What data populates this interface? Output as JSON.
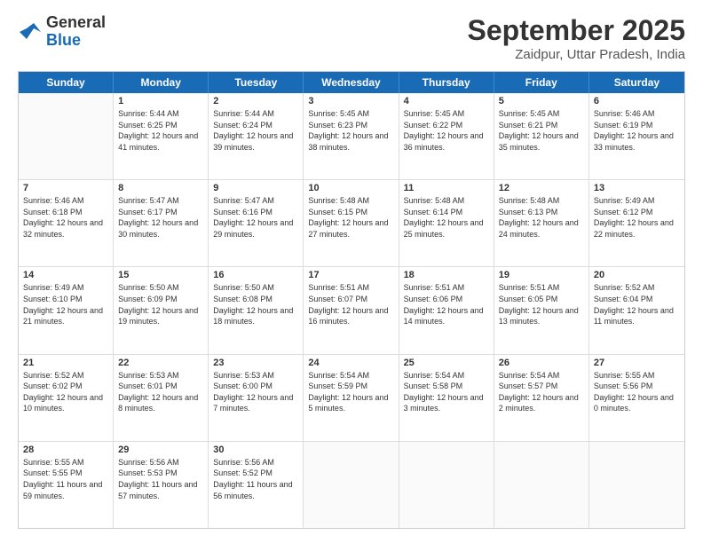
{
  "logo": {
    "general": "General",
    "blue": "Blue"
  },
  "header": {
    "month": "September 2025",
    "location": "Zaidpur, Uttar Pradesh, India"
  },
  "days": [
    "Sunday",
    "Monday",
    "Tuesday",
    "Wednesday",
    "Thursday",
    "Friday",
    "Saturday"
  ],
  "rows": [
    [
      {
        "day": "",
        "empty": true
      },
      {
        "day": "1",
        "sunrise": "Sunrise: 5:44 AM",
        "sunset": "Sunset: 6:25 PM",
        "daylight": "Daylight: 12 hours and 41 minutes."
      },
      {
        "day": "2",
        "sunrise": "Sunrise: 5:44 AM",
        "sunset": "Sunset: 6:24 PM",
        "daylight": "Daylight: 12 hours and 39 minutes."
      },
      {
        "day": "3",
        "sunrise": "Sunrise: 5:45 AM",
        "sunset": "Sunset: 6:23 PM",
        "daylight": "Daylight: 12 hours and 38 minutes."
      },
      {
        "day": "4",
        "sunrise": "Sunrise: 5:45 AM",
        "sunset": "Sunset: 6:22 PM",
        "daylight": "Daylight: 12 hours and 36 minutes."
      },
      {
        "day": "5",
        "sunrise": "Sunrise: 5:45 AM",
        "sunset": "Sunset: 6:21 PM",
        "daylight": "Daylight: 12 hours and 35 minutes."
      },
      {
        "day": "6",
        "sunrise": "Sunrise: 5:46 AM",
        "sunset": "Sunset: 6:19 PM",
        "daylight": "Daylight: 12 hours and 33 minutes."
      }
    ],
    [
      {
        "day": "7",
        "sunrise": "Sunrise: 5:46 AM",
        "sunset": "Sunset: 6:18 PM",
        "daylight": "Daylight: 12 hours and 32 minutes."
      },
      {
        "day": "8",
        "sunrise": "Sunrise: 5:47 AM",
        "sunset": "Sunset: 6:17 PM",
        "daylight": "Daylight: 12 hours and 30 minutes."
      },
      {
        "day": "9",
        "sunrise": "Sunrise: 5:47 AM",
        "sunset": "Sunset: 6:16 PM",
        "daylight": "Daylight: 12 hours and 29 minutes."
      },
      {
        "day": "10",
        "sunrise": "Sunrise: 5:48 AM",
        "sunset": "Sunset: 6:15 PM",
        "daylight": "Daylight: 12 hours and 27 minutes."
      },
      {
        "day": "11",
        "sunrise": "Sunrise: 5:48 AM",
        "sunset": "Sunset: 6:14 PM",
        "daylight": "Daylight: 12 hours and 25 minutes."
      },
      {
        "day": "12",
        "sunrise": "Sunrise: 5:48 AM",
        "sunset": "Sunset: 6:13 PM",
        "daylight": "Daylight: 12 hours and 24 minutes."
      },
      {
        "day": "13",
        "sunrise": "Sunrise: 5:49 AM",
        "sunset": "Sunset: 6:12 PM",
        "daylight": "Daylight: 12 hours and 22 minutes."
      }
    ],
    [
      {
        "day": "14",
        "sunrise": "Sunrise: 5:49 AM",
        "sunset": "Sunset: 6:10 PM",
        "daylight": "Daylight: 12 hours and 21 minutes."
      },
      {
        "day": "15",
        "sunrise": "Sunrise: 5:50 AM",
        "sunset": "Sunset: 6:09 PM",
        "daylight": "Daylight: 12 hours and 19 minutes."
      },
      {
        "day": "16",
        "sunrise": "Sunrise: 5:50 AM",
        "sunset": "Sunset: 6:08 PM",
        "daylight": "Daylight: 12 hours and 18 minutes."
      },
      {
        "day": "17",
        "sunrise": "Sunrise: 5:51 AM",
        "sunset": "Sunset: 6:07 PM",
        "daylight": "Daylight: 12 hours and 16 minutes."
      },
      {
        "day": "18",
        "sunrise": "Sunrise: 5:51 AM",
        "sunset": "Sunset: 6:06 PM",
        "daylight": "Daylight: 12 hours and 14 minutes."
      },
      {
        "day": "19",
        "sunrise": "Sunrise: 5:51 AM",
        "sunset": "Sunset: 6:05 PM",
        "daylight": "Daylight: 12 hours and 13 minutes."
      },
      {
        "day": "20",
        "sunrise": "Sunrise: 5:52 AM",
        "sunset": "Sunset: 6:04 PM",
        "daylight": "Daylight: 12 hours and 11 minutes."
      }
    ],
    [
      {
        "day": "21",
        "sunrise": "Sunrise: 5:52 AM",
        "sunset": "Sunset: 6:02 PM",
        "daylight": "Daylight: 12 hours and 10 minutes."
      },
      {
        "day": "22",
        "sunrise": "Sunrise: 5:53 AM",
        "sunset": "Sunset: 6:01 PM",
        "daylight": "Daylight: 12 hours and 8 minutes."
      },
      {
        "day": "23",
        "sunrise": "Sunrise: 5:53 AM",
        "sunset": "Sunset: 6:00 PM",
        "daylight": "Daylight: 12 hours and 7 minutes."
      },
      {
        "day": "24",
        "sunrise": "Sunrise: 5:54 AM",
        "sunset": "Sunset: 5:59 PM",
        "daylight": "Daylight: 12 hours and 5 minutes."
      },
      {
        "day": "25",
        "sunrise": "Sunrise: 5:54 AM",
        "sunset": "Sunset: 5:58 PM",
        "daylight": "Daylight: 12 hours and 3 minutes."
      },
      {
        "day": "26",
        "sunrise": "Sunrise: 5:54 AM",
        "sunset": "Sunset: 5:57 PM",
        "daylight": "Daylight: 12 hours and 2 minutes."
      },
      {
        "day": "27",
        "sunrise": "Sunrise: 5:55 AM",
        "sunset": "Sunset: 5:56 PM",
        "daylight": "Daylight: 12 hours and 0 minutes."
      }
    ],
    [
      {
        "day": "28",
        "sunrise": "Sunrise: 5:55 AM",
        "sunset": "Sunset: 5:55 PM",
        "daylight": "Daylight: 11 hours and 59 minutes."
      },
      {
        "day": "29",
        "sunrise": "Sunrise: 5:56 AM",
        "sunset": "Sunset: 5:53 PM",
        "daylight": "Daylight: 11 hours and 57 minutes."
      },
      {
        "day": "30",
        "sunrise": "Sunrise: 5:56 AM",
        "sunset": "Sunset: 5:52 PM",
        "daylight": "Daylight: 11 hours and 56 minutes."
      },
      {
        "day": "",
        "empty": true
      },
      {
        "day": "",
        "empty": true
      },
      {
        "day": "",
        "empty": true
      },
      {
        "day": "",
        "empty": true
      }
    ]
  ]
}
